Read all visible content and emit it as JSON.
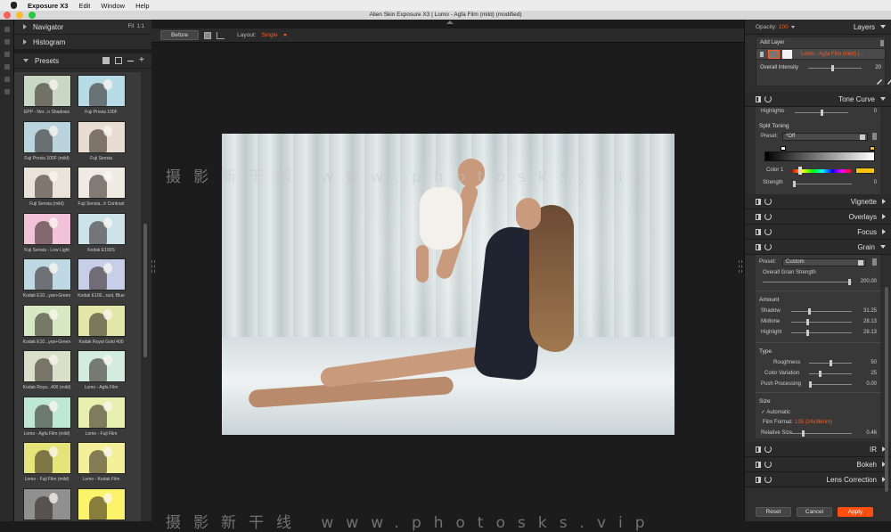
{
  "menubar": {
    "app": "Exposure X3",
    "items": [
      "Edit",
      "Window",
      "Help"
    ]
  },
  "window": {
    "title": "Alien Skin Exposure X3 | Lomo - Agfa Film (mild) (modified)"
  },
  "left_panel": {
    "navigator": {
      "label": "Navigator",
      "zoom_fit": "Fit",
      "zoom_1": "1:1"
    },
    "histogram": {
      "label": "Histogram"
    },
    "presets": {
      "label": "Presets",
      "items": [
        "EPP - Nor...n Shadows",
        "Fuji Provia 100F",
        "Fuji Provia 100F (mild)",
        "Fuji Sensia",
        "Fuji Sensia (mild)",
        "Fuji Sensia...h Contrast",
        "Fuji Sensia - Low Light",
        "Kodak E100S",
        "Kodak E10...yan+Green",
        "Kodak E100...rast, Blue",
        "Kodak E10...yan+Green",
        "Kodak Royal Gold 400",
        "Kodak Roya...400 (mild)",
        "Lomo - Agfa Film",
        "Lomo - Agfa Film (mild)",
        "Lomo - Fuji Film",
        "Lomo - Fuji Film (mild)",
        "Lomo - Kodak Film",
        "",
        ""
      ],
      "thumb_tints": [
        "#c9d8c4",
        "#b8dce6",
        "#b9d4dd",
        "#e8ddd0",
        "#e9e3da",
        "#f0ece4",
        "#f2c3d8",
        "#cde3ea",
        "#bfd9e4",
        "#c7cfe8",
        "#d6e9c2",
        "#e3e8a9",
        "#d9dfc8",
        "#d2ece0",
        "#bfe8d2",
        "#e8f0b0",
        "#e4e47a",
        "#f4f09a",
        "#909090",
        "#fbf36a"
      ]
    }
  },
  "center": {
    "toolbar": {
      "before": "Before",
      "layout_label": "Layout:",
      "layout_value": "Single"
    },
    "watermark": "摄影新干线 www.photosks.vip",
    "watermark_bottom": "摄影新干线 www.photosks.vip"
  },
  "right_panel": {
    "opacity_label": "Opacity:",
    "opacity_value": "100",
    "layers_title": "Layers",
    "add_layer": "Add Layer",
    "layer_name": "Lomo - Agfa Film (mild) (...",
    "overall_intensity_label": "Overall Intensity",
    "overall_intensity_value": "20",
    "overall_intensity_level": 0.45,
    "tone_curve": {
      "title": "Tone Curve",
      "highlights_label": "Highlights",
      "highlights_value": "0",
      "highlights_level": 0.5
    },
    "split_toning": {
      "title": "Split Toning",
      "preset_label": "Preset:",
      "preset_value": "*Off",
      "color1_label": "Color 1",
      "strength_label": "Strength",
      "strength_value": "0",
      "color1_swatch": "#ffc20e"
    },
    "sections_collapsed": [
      "Vignette",
      "Overlays",
      "Focus"
    ],
    "grain": {
      "title": "Grain",
      "preset_label": "Preset:",
      "preset_value": "Custom",
      "overall_label": "Overall Grain Strength",
      "overall_value": "200.00",
      "amount_label": "Amount",
      "shadow_label": "Shadow",
      "shadow_value": "31.25",
      "midtone_label": "Midtone",
      "midtone_value": "28.13",
      "highlight_label": "Highlight",
      "highlight_value": "28.13",
      "type_label": "Type",
      "roughness_label": "Roughness",
      "roughness_value": "50",
      "color_variation_label": "Color Variation",
      "color_variation_value": "25",
      "push_label": "Push Processing",
      "push_value": "0.00",
      "size_label": "Size",
      "automatic_label": "Automatic",
      "film_format_label": "Film Format:",
      "film_format_value": "135 (24x36mm)",
      "relative_size_label": "Relative Size",
      "relative_size_value": "0.46"
    },
    "sections_bottom": [
      "IR",
      "Bokeh",
      "Lens Correction"
    ],
    "buttons": {
      "reset": "Reset",
      "cancel": "Cancel",
      "apply": "Apply"
    },
    "accent_color": "#ff5a1f"
  }
}
